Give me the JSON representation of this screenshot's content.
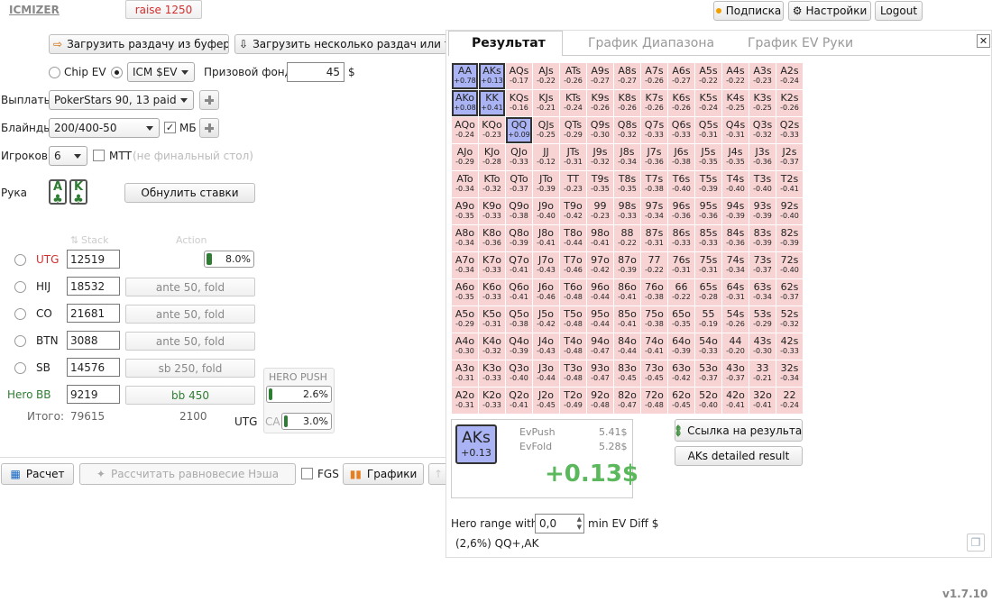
{
  "header": {
    "logo": "ICMIZER",
    "subscribe": "Подписка",
    "settings": "Настройки",
    "logout": "Logout"
  },
  "left": {
    "load_clip": "Загрузить раздачу из буфера",
    "load_many": "Загрузить несколько раздач или тур",
    "chip_ev": "Chip EV",
    "icm_select": "ICM $EV",
    "prize_label": "Призовой фонд",
    "prize_value": "45",
    "prize_unit": "$",
    "payouts_label": "Выплаты",
    "payouts_value": "PokerStars 90, 13 paid",
    "blinds_label": "Блайнды",
    "blinds_value": "200/400-50",
    "bb_label": "МБ",
    "players_label": "Игроков",
    "players_value": "6",
    "mtt_label": "МТТ",
    "mtt_note": "(не финальный стол)",
    "hand_label": "Рука",
    "card1": "A",
    "card2": "K",
    "reset": "Обнулить ставки",
    "col_stack": "Stack",
    "col_action": "Action",
    "players": [
      {
        "pos": "UTG",
        "stack": "12519",
        "action": "raise 1250",
        "pct": "8.0%"
      },
      {
        "pos": "HIJ",
        "stack": "18532",
        "action": "ante 50, fold"
      },
      {
        "pos": "CO",
        "stack": "21681",
        "action": "ante 50, fold"
      },
      {
        "pos": "BTN",
        "stack": "3088",
        "action": "ante 50, fold"
      },
      {
        "pos": "SB",
        "stack": "14576",
        "action": "sb 250, fold"
      },
      {
        "pos": "BB",
        "stack": "9219",
        "action": "bb 450",
        "hero": "Hero"
      }
    ],
    "total_label": "Итого:",
    "total_stack": "79615",
    "total_action": "2100",
    "hero_push_title": "HERO PUSH",
    "hero_push_pct": "2.6%",
    "hero_push_value": 0.026,
    "utg_label": "UTG",
    "ca_label": "CA",
    "ca_pct": "3.0%",
    "ca_value": 0.03,
    "utg_fill_value": 0.08,
    "calc": "Расчет",
    "nash": "Рассчитать равновесие Нэша",
    "fgs": "FGS",
    "charts": "Графики"
  },
  "tabs": [
    "Результат",
    "График Диапазона",
    "График EV Руки"
  ],
  "matrix": {
    "rows": [
      [
        [
          "AA",
          "+0.78"
        ],
        [
          "AKs",
          "+0.13"
        ],
        [
          "AQs",
          "-0.17"
        ],
        [
          "AJs",
          "-0.22"
        ],
        [
          "ATs",
          "-0.26"
        ],
        [
          "A9s",
          "-0.27"
        ],
        [
          "A8s",
          "-0.27"
        ],
        [
          "A7s",
          "-0.26"
        ],
        [
          "A6s",
          "-0.27"
        ],
        [
          "A5s",
          "-0.22"
        ],
        [
          "A4s",
          "-0.22"
        ],
        [
          "A3s",
          "-0.23"
        ],
        [
          "A2s",
          "-0.24"
        ]
      ],
      [
        [
          "AKo",
          "+0.08"
        ],
        [
          "KK",
          "+0.41"
        ],
        [
          "KQs",
          "-0.16"
        ],
        [
          "KJs",
          "-0.21"
        ],
        [
          "KTs",
          "-0.24"
        ],
        [
          "K9s",
          "-0.26"
        ],
        [
          "K8s",
          "-0.26"
        ],
        [
          "K7s",
          "-0.26"
        ],
        [
          "K6s",
          "-0.26"
        ],
        [
          "K5s",
          "-0.24"
        ],
        [
          "K4s",
          "-0.25"
        ],
        [
          "K3s",
          "-0.25"
        ],
        [
          "K2s",
          "-0.26"
        ]
      ],
      [
        [
          "AQo",
          "-0.24"
        ],
        [
          "KQo",
          "-0.23"
        ],
        [
          "QQ",
          "+0.09"
        ],
        [
          "QJs",
          "-0.25"
        ],
        [
          "QTs",
          "-0.29"
        ],
        [
          "Q9s",
          "-0.30"
        ],
        [
          "Q8s",
          "-0.32"
        ],
        [
          "Q7s",
          "-0.33"
        ],
        [
          "Q6s",
          "-0.33"
        ],
        [
          "Q5s",
          "-0.31"
        ],
        [
          "Q4s",
          "-0.31"
        ],
        [
          "Q3s",
          "-0.32"
        ],
        [
          "Q2s",
          "-0.33"
        ]
      ],
      [
        [
          "AJo",
          "-0.29"
        ],
        [
          "KJo",
          "-0.28"
        ],
        [
          "QJo",
          "-0.33"
        ],
        [
          "JJ",
          "-0.12"
        ],
        [
          "JTs",
          "-0.31"
        ],
        [
          "J9s",
          "-0.32"
        ],
        [
          "J8s",
          "-0.34"
        ],
        [
          "J7s",
          "-0.36"
        ],
        [
          "J6s",
          "-0.38"
        ],
        [
          "J5s",
          "-0.35"
        ],
        [
          "J4s",
          "-0.35"
        ],
        [
          "J3s",
          "-0.36"
        ],
        [
          "J2s",
          "-0.37"
        ]
      ],
      [
        [
          "ATo",
          "-0.34"
        ],
        [
          "KTo",
          "-0.32"
        ],
        [
          "QTo",
          "-0.37"
        ],
        [
          "JTo",
          "-0.39"
        ],
        [
          "TT",
          "-0.23"
        ],
        [
          "T9s",
          "-0.35"
        ],
        [
          "T8s",
          "-0.35"
        ],
        [
          "T7s",
          "-0.38"
        ],
        [
          "T6s",
          "-0.40"
        ],
        [
          "T5s",
          "-0.39"
        ],
        [
          "T4s",
          "-0.40"
        ],
        [
          "T3s",
          "-0.40"
        ],
        [
          "T2s",
          "-0.41"
        ]
      ],
      [
        [
          "A9o",
          "-0.35"
        ],
        [
          "K9o",
          "-0.33"
        ],
        [
          "Q9o",
          "-0.38"
        ],
        [
          "J9o",
          "-0.40"
        ],
        [
          "T9o",
          "-0.42"
        ],
        [
          "99",
          "-0.23"
        ],
        [
          "98s",
          "-0.33"
        ],
        [
          "97s",
          "-0.34"
        ],
        [
          "96s",
          "-0.36"
        ],
        [
          "95s",
          "-0.36"
        ],
        [
          "94s",
          "-0.39"
        ],
        [
          "93s",
          "-0.39"
        ],
        [
          "92s",
          "-0.40"
        ]
      ],
      [
        [
          "A8o",
          "-0.34"
        ],
        [
          "K8o",
          "-0.36"
        ],
        [
          "Q8o",
          "-0.39"
        ],
        [
          "J8o",
          "-0.41"
        ],
        [
          "T8o",
          "-0.44"
        ],
        [
          "98o",
          "-0.41"
        ],
        [
          "88",
          "-0.22"
        ],
        [
          "87s",
          "-0.31"
        ],
        [
          "86s",
          "-0.33"
        ],
        [
          "85s",
          "-0.33"
        ],
        [
          "84s",
          "-0.36"
        ],
        [
          "83s",
          "-0.39"
        ],
        [
          "82s",
          "-0.39"
        ]
      ],
      [
        [
          "A7o",
          "-0.34"
        ],
        [
          "K7o",
          "-0.33"
        ],
        [
          "Q7o",
          "-0.41"
        ],
        [
          "J7o",
          "-0.43"
        ],
        [
          "T7o",
          "-0.46"
        ],
        [
          "97o",
          "-0.42"
        ],
        [
          "87o",
          "-0.39"
        ],
        [
          "77",
          "-0.22"
        ],
        [
          "76s",
          "-0.31"
        ],
        [
          "75s",
          "-0.31"
        ],
        [
          "74s",
          "-0.34"
        ],
        [
          "73s",
          "-0.37"
        ],
        [
          "72s",
          "-0.40"
        ]
      ],
      [
        [
          "A6o",
          "-0.35"
        ],
        [
          "K6o",
          "-0.33"
        ],
        [
          "Q6o",
          "-0.41"
        ],
        [
          "J6o",
          "-0.46"
        ],
        [
          "T6o",
          "-0.48"
        ],
        [
          "96o",
          "-0.44"
        ],
        [
          "86o",
          "-0.41"
        ],
        [
          "76o",
          "-0.38"
        ],
        [
          "66",
          "-0.22"
        ],
        [
          "65s",
          "-0.28"
        ],
        [
          "64s",
          "-0.31"
        ],
        [
          "63s",
          "-0.34"
        ],
        [
          "62s",
          "-0.37"
        ]
      ],
      [
        [
          "A5o",
          "-0.29"
        ],
        [
          "K5o",
          "-0.31"
        ],
        [
          "Q5o",
          "-0.38"
        ],
        [
          "J5o",
          "-0.42"
        ],
        [
          "T5o",
          "-0.48"
        ],
        [
          "95o",
          "-0.44"
        ],
        [
          "85o",
          "-0.41"
        ],
        [
          "75o",
          "-0.38"
        ],
        [
          "65o",
          "-0.35"
        ],
        [
          "55",
          "-0.19"
        ],
        [
          "54s",
          "-0.26"
        ],
        [
          "53s",
          "-0.29"
        ],
        [
          "52s",
          "-0.32"
        ]
      ],
      [
        [
          "A4o",
          "-0.30"
        ],
        [
          "K4o",
          "-0.32"
        ],
        [
          "Q4o",
          "-0.39"
        ],
        [
          "J4o",
          "-0.43"
        ],
        [
          "T4o",
          "-0.48"
        ],
        [
          "94o",
          "-0.47"
        ],
        [
          "84o",
          "-0.44"
        ],
        [
          "74o",
          "-0.41"
        ],
        [
          "64o",
          "-0.39"
        ],
        [
          "54o",
          "-0.33"
        ],
        [
          "44",
          "-0.20"
        ],
        [
          "43s",
          "-0.30"
        ],
        [
          "42s",
          "-0.33"
        ]
      ],
      [
        [
          "A3o",
          "-0.31"
        ],
        [
          "K3o",
          "-0.33"
        ],
        [
          "Q3o",
          "-0.40"
        ],
        [
          "J3o",
          "-0.44"
        ],
        [
          "T3o",
          "-0.48"
        ],
        [
          "93o",
          "-0.47"
        ],
        [
          "83o",
          "-0.45"
        ],
        [
          "73o",
          "-0.45"
        ],
        [
          "63o",
          "-0.42"
        ],
        [
          "53o",
          "-0.37"
        ],
        [
          "43o",
          "-0.37"
        ],
        [
          "33",
          "-0.21"
        ],
        [
          "32s",
          "-0.34"
        ]
      ],
      [
        [
          "A2o",
          "-0.31"
        ],
        [
          "K2o",
          "-0.33"
        ],
        [
          "Q2o",
          "-0.41"
        ],
        [
          "J2o",
          "-0.45"
        ],
        [
          "T2o",
          "-0.49"
        ],
        [
          "92o",
          "-0.48"
        ],
        [
          "82o",
          "-0.47"
        ],
        [
          "72o",
          "-0.48"
        ],
        [
          "62o",
          "-0.45"
        ],
        [
          "52o",
          "-0.40"
        ],
        [
          "42o",
          "-0.41"
        ],
        [
          "32o",
          "-0.41"
        ],
        [
          "22",
          "-0.24"
        ]
      ]
    ],
    "selected": [
      "AA",
      "AKs",
      "AKo",
      "KK",
      "QQ"
    ],
    "active": "AKs"
  },
  "result": {
    "hand": "AKs",
    "hand_ev": "+0.13",
    "evpush_label": "EvPush",
    "evpush": "5.41$",
    "evfold_label": "EvFold",
    "evfold": "5.28$",
    "diff": "+0.13$",
    "link": "Ссылка на результат",
    "detailed": "AKs detailed result",
    "hero_range_label": "Hero range with",
    "hero_range_value": "0,0",
    "hero_range_suffix": "min EV Diff $",
    "range_text": "(2,6%) QQ+,AK"
  },
  "version": "v1.7.10",
  "colors": {
    "accent_green": "#2e7d32",
    "ev_green": "#5cb85c",
    "cell_red": "#f7d3d3",
    "cell_selected": "#aab4f4",
    "utg_red": "#d32f2f"
  }
}
